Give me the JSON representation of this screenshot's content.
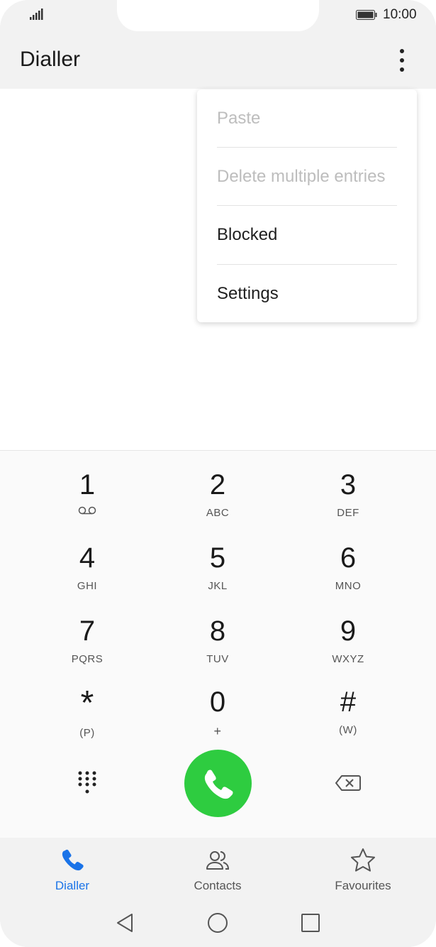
{
  "status_bar": {
    "time": "10:00"
  },
  "app_bar": {
    "title": "Dialler"
  },
  "overflow_menu": {
    "items": [
      {
        "label": "Paste",
        "enabled": false
      },
      {
        "label": "Delete multiple entries",
        "enabled": false
      },
      {
        "label": "Blocked",
        "enabled": true
      },
      {
        "label": "Settings",
        "enabled": true
      }
    ]
  },
  "keypad": {
    "keys": [
      {
        "digit": "1",
        "sub": "",
        "sub_icon": "voicemail-icon"
      },
      {
        "digit": "2",
        "sub": "ABC"
      },
      {
        "digit": "3",
        "sub": "DEF"
      },
      {
        "digit": "4",
        "sub": "GHI"
      },
      {
        "digit": "5",
        "sub": "JKL"
      },
      {
        "digit": "6",
        "sub": "MNO"
      },
      {
        "digit": "7",
        "sub": "PQRS"
      },
      {
        "digit": "8",
        "sub": "TUV"
      },
      {
        "digit": "9",
        "sub": "WXYZ"
      },
      {
        "digit": "*",
        "sub": "(P)"
      },
      {
        "digit": "0",
        "sub": "+"
      },
      {
        "digit": "#",
        "sub": "(W)"
      }
    ],
    "call_button_color": "#2ecc40"
  },
  "tabs": [
    {
      "label": "Dialler",
      "icon": "phone-icon",
      "active": true
    },
    {
      "label": "Contacts",
      "icon": "contacts-icon",
      "active": false
    },
    {
      "label": "Favourites",
      "icon": "star-icon",
      "active": false
    }
  ],
  "colors": {
    "accent": "#1a73e8"
  }
}
